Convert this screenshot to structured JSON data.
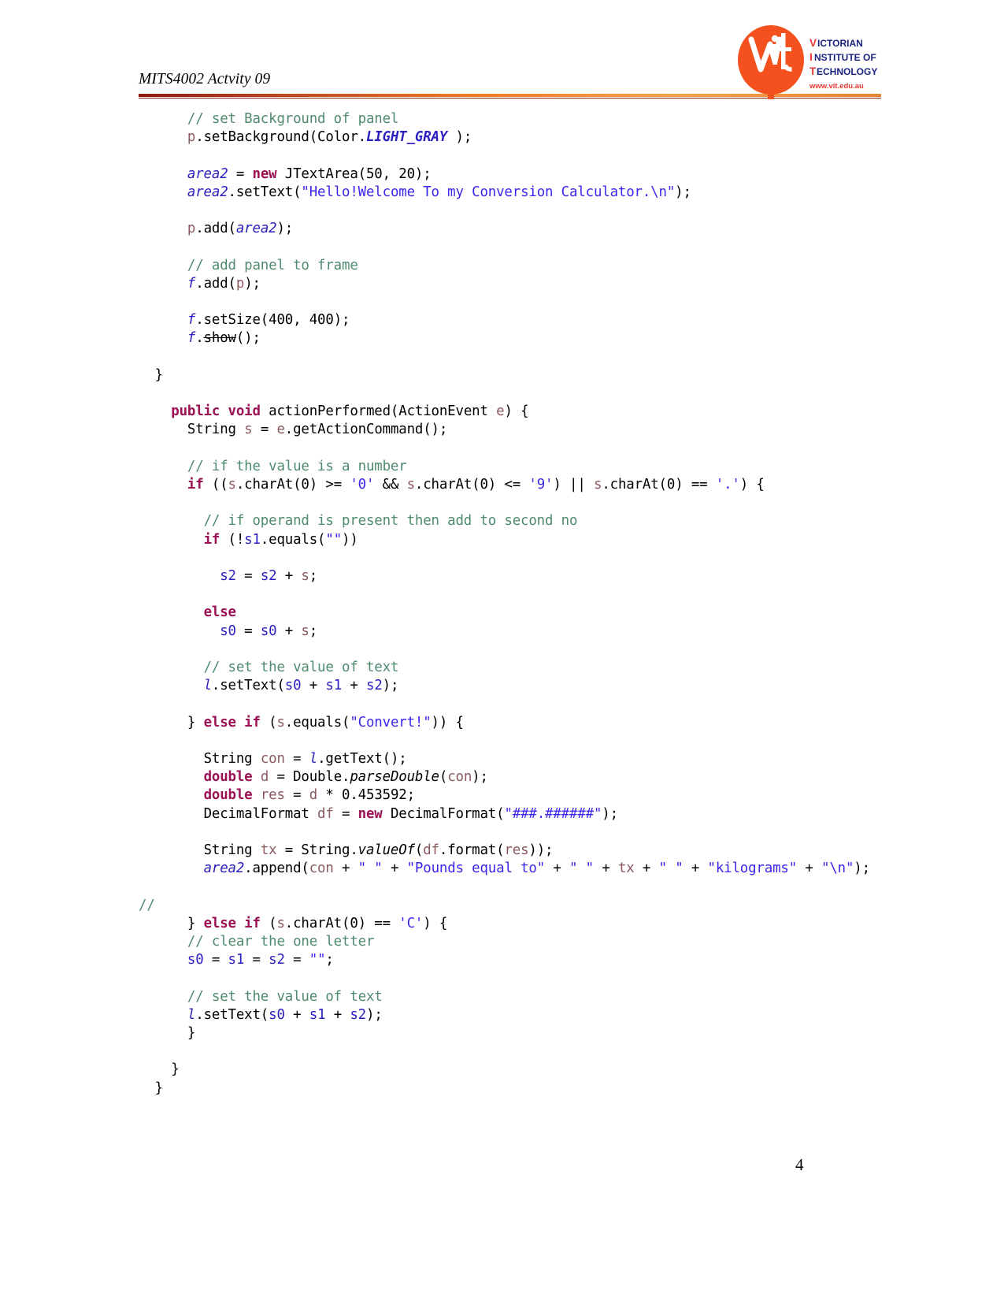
{
  "document": {
    "header_title": "MITS4002 Actvity 09",
    "page_number": "4"
  },
  "logo": {
    "name": "vit-logo",
    "mark_letters": "vit",
    "line1": "VICTORIAN",
    "line2": "INSTITUTE OF",
    "line3": "TECHNOLOGY",
    "website": "www.vit.edu.au",
    "colors": {
      "orange": "#F4511E",
      "blue": "#1A237E",
      "red": "#E53935",
      "maroon": "#7e1a10"
    }
  },
  "theme": {
    "comment": "#4f8a6d",
    "keyword": "#9c1054",
    "string": "#3b26ec",
    "field": "#2a1fbe",
    "local": "#8a5a5e",
    "text": "#000000"
  },
  "code": {
    "language": "java",
    "lines": [
      {
        "indent": 3,
        "tokens": [
          {
            "t": "cmt",
            "v": "// set Background of panel"
          }
        ]
      },
      {
        "indent": 3,
        "tokens": [
          {
            "t": "loc",
            "v": "p"
          },
          {
            "t": "plain",
            "v": ".setBackground(Color."
          },
          {
            "t": "cons",
            "v": "LIGHT_GRAY"
          },
          {
            "t": "plain",
            "v": " );"
          }
        ]
      },
      {
        "blank": true
      },
      {
        "indent": 3,
        "tokens": [
          {
            "t": "fld",
            "v": "area2"
          },
          {
            "t": "plain",
            "v": " = "
          },
          {
            "t": "kw",
            "v": "new"
          },
          {
            "t": "plain",
            "v": " JTextArea(50, 20);"
          }
        ]
      },
      {
        "indent": 3,
        "tokens": [
          {
            "t": "fld",
            "v": "area2"
          },
          {
            "t": "plain",
            "v": ".setText("
          },
          {
            "t": "str",
            "v": "\"Hello!Welcome To my Conversion Calculator.\\n\""
          },
          {
            "t": "plain",
            "v": ");"
          }
        ]
      },
      {
        "blank": true
      },
      {
        "indent": 3,
        "tokens": [
          {
            "t": "loc",
            "v": "p"
          },
          {
            "t": "plain",
            "v": ".add("
          },
          {
            "t": "fld",
            "v": "area2"
          },
          {
            "t": "plain",
            "v": ");"
          }
        ]
      },
      {
        "blank": true
      },
      {
        "indent": 3,
        "tokens": [
          {
            "t": "cmt",
            "v": "// add panel to frame"
          }
        ]
      },
      {
        "indent": 3,
        "tokens": [
          {
            "t": "fld",
            "v": "f"
          },
          {
            "t": "plain",
            "v": ".add("
          },
          {
            "t": "loc",
            "v": "p"
          },
          {
            "t": "plain",
            "v": ");"
          }
        ]
      },
      {
        "blank": true
      },
      {
        "indent": 3,
        "tokens": [
          {
            "t": "fld",
            "v": "f"
          },
          {
            "t": "plain",
            "v": ".setSize(400, 400);"
          }
        ]
      },
      {
        "indent": 3,
        "tokens": [
          {
            "t": "fld",
            "v": "f"
          },
          {
            "t": "plain",
            "v": "."
          },
          {
            "t": "strike",
            "v": "show"
          },
          {
            "t": "plain",
            "v": "();"
          }
        ]
      },
      {
        "blank": true
      },
      {
        "indent": 1,
        "tokens": [
          {
            "t": "plain",
            "v": "}"
          }
        ]
      },
      {
        "blank": true
      },
      {
        "indent": 2,
        "tokens": [
          {
            "t": "kw",
            "v": "public void"
          },
          {
            "t": "plain",
            "v": " actionPerformed(ActionEvent "
          },
          {
            "t": "loc",
            "v": "e"
          },
          {
            "t": "plain",
            "v": ") {"
          }
        ]
      },
      {
        "indent": 3,
        "tokens": [
          {
            "t": "plain",
            "v": "String "
          },
          {
            "t": "loc",
            "v": "s"
          },
          {
            "t": "plain",
            "v": " = "
          },
          {
            "t": "loc",
            "v": "e"
          },
          {
            "t": "plain",
            "v": ".getActionCommand();"
          }
        ]
      },
      {
        "blank": true
      },
      {
        "indent": 3,
        "tokens": [
          {
            "t": "cmt",
            "v": "// if the value is a number"
          }
        ]
      },
      {
        "indent": 3,
        "wrap": true,
        "tokens": [
          {
            "t": "kw",
            "v": "if"
          },
          {
            "t": "plain",
            "v": " (("
          },
          {
            "t": "loc",
            "v": "s"
          },
          {
            "t": "plain",
            "v": ".charAt(0) >= "
          },
          {
            "t": "chr",
            "v": "'0'"
          },
          {
            "t": "plain",
            "v": " && "
          },
          {
            "t": "loc",
            "v": "s"
          },
          {
            "t": "plain",
            "v": ".charAt(0) <= "
          },
          {
            "t": "chr",
            "v": "'9'"
          },
          {
            "t": "plain",
            "v": ") || "
          },
          {
            "t": "loc",
            "v": "s"
          },
          {
            "t": "plain",
            "v": ".charAt(0) == "
          },
          {
            "t": "chr",
            "v": "'.'"
          },
          {
            "t": "plain",
            "v": ") {"
          }
        ]
      },
      {
        "blank": true
      },
      {
        "indent": 4,
        "tokens": [
          {
            "t": "cmt",
            "v": "// if operand is present then add to second no"
          }
        ]
      },
      {
        "indent": 4,
        "tokens": [
          {
            "t": "kw",
            "v": "if"
          },
          {
            "t": "plain",
            "v": " (!"
          },
          {
            "t": "var",
            "v": "s1"
          },
          {
            "t": "plain",
            "v": ".equals("
          },
          {
            "t": "str",
            "v": "\"\""
          },
          {
            "t": "plain",
            "v": "))"
          }
        ]
      },
      {
        "blank": true
      },
      {
        "indent": 5,
        "tokens": [
          {
            "t": "var",
            "v": "s2"
          },
          {
            "t": "plain",
            "v": " = "
          },
          {
            "t": "var",
            "v": "s2"
          },
          {
            "t": "plain",
            "v": " + "
          },
          {
            "t": "loc",
            "v": "s"
          },
          {
            "t": "plain",
            "v": ";"
          }
        ]
      },
      {
        "blank": true
      },
      {
        "indent": 4,
        "tokens": [
          {
            "t": "kw",
            "v": "else"
          }
        ]
      },
      {
        "indent": 5,
        "tokens": [
          {
            "t": "var",
            "v": "s0"
          },
          {
            "t": "plain",
            "v": " = "
          },
          {
            "t": "var",
            "v": "s0"
          },
          {
            "t": "plain",
            "v": " + "
          },
          {
            "t": "loc",
            "v": "s"
          },
          {
            "t": "plain",
            "v": ";"
          }
        ]
      },
      {
        "blank": true
      },
      {
        "indent": 4,
        "tokens": [
          {
            "t": "cmt",
            "v": "// set the value of text"
          }
        ]
      },
      {
        "indent": 4,
        "tokens": [
          {
            "t": "fld",
            "v": "l"
          },
          {
            "t": "plain",
            "v": ".setText("
          },
          {
            "t": "var",
            "v": "s0"
          },
          {
            "t": "plain",
            "v": " + "
          },
          {
            "t": "var",
            "v": "s1"
          },
          {
            "t": "plain",
            "v": " + "
          },
          {
            "t": "var",
            "v": "s2"
          },
          {
            "t": "plain",
            "v": ");"
          }
        ]
      },
      {
        "blank": true
      },
      {
        "indent": 3,
        "tokens": [
          {
            "t": "plain",
            "v": "} "
          },
          {
            "t": "kw",
            "v": "else if"
          },
          {
            "t": "plain",
            "v": " ("
          },
          {
            "t": "loc",
            "v": "s"
          },
          {
            "t": "plain",
            "v": ".equals("
          },
          {
            "t": "str",
            "v": "\"Convert!\""
          },
          {
            "t": "plain",
            "v": ")) {"
          }
        ]
      },
      {
        "blank": true
      },
      {
        "indent": 4,
        "tokens": [
          {
            "t": "plain",
            "v": "String "
          },
          {
            "t": "loc",
            "v": "con"
          },
          {
            "t": "plain",
            "v": " = "
          },
          {
            "t": "fld",
            "v": "l"
          },
          {
            "t": "plain",
            "v": ".getText();"
          }
        ]
      },
      {
        "indent": 4,
        "tokens": [
          {
            "t": "kw",
            "v": "double"
          },
          {
            "t": "plain",
            "v": " "
          },
          {
            "t": "loc",
            "v": "d"
          },
          {
            "t": "plain",
            "v": " = Double."
          },
          {
            "t": "mth",
            "v": "parseDouble"
          },
          {
            "t": "plain",
            "v": "("
          },
          {
            "t": "loc",
            "v": "con"
          },
          {
            "t": "plain",
            "v": ");"
          }
        ]
      },
      {
        "indent": 4,
        "tokens": [
          {
            "t": "kw",
            "v": "double"
          },
          {
            "t": "plain",
            "v": " "
          },
          {
            "t": "loc",
            "v": "res"
          },
          {
            "t": "plain",
            "v": " = "
          },
          {
            "t": "loc",
            "v": "d"
          },
          {
            "t": "plain",
            "v": " * 0.453592;"
          }
        ]
      },
      {
        "indent": 4,
        "tokens": [
          {
            "t": "plain",
            "v": "DecimalFormat "
          },
          {
            "t": "loc",
            "v": "df"
          },
          {
            "t": "plain",
            "v": " = "
          },
          {
            "t": "kw",
            "v": "new"
          },
          {
            "t": "plain",
            "v": " DecimalFormat("
          },
          {
            "t": "str",
            "v": "\"###.######\""
          },
          {
            "t": "plain",
            "v": ");"
          }
        ]
      },
      {
        "blank": true
      },
      {
        "indent": 4,
        "tokens": [
          {
            "t": "plain",
            "v": "String "
          },
          {
            "t": "loc",
            "v": "tx"
          },
          {
            "t": "plain",
            "v": " = String."
          },
          {
            "t": "mth",
            "v": "valueOf"
          },
          {
            "t": "plain",
            "v": "("
          },
          {
            "t": "loc",
            "v": "df"
          },
          {
            "t": "plain",
            "v": ".format("
          },
          {
            "t": "loc",
            "v": "res"
          },
          {
            "t": "plain",
            "v": "));"
          }
        ]
      },
      {
        "indent": 4,
        "wrap": true,
        "tokens": [
          {
            "t": "fld",
            "v": "area2"
          },
          {
            "t": "plain",
            "v": ".append("
          },
          {
            "t": "loc",
            "v": "con"
          },
          {
            "t": "plain",
            "v": " + "
          },
          {
            "t": "str",
            "v": "\" \""
          },
          {
            "t": "plain",
            "v": " + "
          },
          {
            "t": "str",
            "v": "\"Pounds equal to\""
          },
          {
            "t": "plain",
            "v": " + "
          },
          {
            "t": "str",
            "v": "\" \""
          },
          {
            "t": "plain",
            "v": " + "
          },
          {
            "t": "loc",
            "v": "tx"
          },
          {
            "t": "plain",
            "v": " + "
          },
          {
            "t": "str",
            "v": "\" \""
          },
          {
            "t": "plain",
            "v": " + "
          },
          {
            "t": "str",
            "v": "\"kilograms\""
          },
          {
            "t": "plain",
            "v": " + "
          },
          {
            "t": "str",
            "v": "\"\\n\""
          },
          {
            "t": "plain",
            "v": ");"
          }
        ]
      },
      {
        "blank": true
      },
      {
        "indent": 0,
        "tokens": [
          {
            "t": "cmt",
            "v": "//"
          }
        ]
      },
      {
        "indent": 3,
        "tokens": [
          {
            "t": "plain",
            "v": "} "
          },
          {
            "t": "kw",
            "v": "else if"
          },
          {
            "t": "plain",
            "v": " ("
          },
          {
            "t": "loc",
            "v": "s"
          },
          {
            "t": "plain",
            "v": ".charAt(0) == "
          },
          {
            "t": "chr",
            "v": "'C'"
          },
          {
            "t": "plain",
            "v": ") {"
          }
        ]
      },
      {
        "indent": 3,
        "tokens": [
          {
            "t": "cmt",
            "v": "// clear the one letter"
          }
        ]
      },
      {
        "indent": 3,
        "tokens": [
          {
            "t": "var",
            "v": "s0"
          },
          {
            "t": "plain",
            "v": " = "
          },
          {
            "t": "var",
            "v": "s1"
          },
          {
            "t": "plain",
            "v": " = "
          },
          {
            "t": "var",
            "v": "s2"
          },
          {
            "t": "plain",
            "v": " = "
          },
          {
            "t": "str",
            "v": "\"\""
          },
          {
            "t": "plain",
            "v": ";"
          }
        ]
      },
      {
        "blank": true
      },
      {
        "indent": 3,
        "tokens": [
          {
            "t": "cmt",
            "v": "// set the value of text"
          }
        ]
      },
      {
        "indent": 3,
        "tokens": [
          {
            "t": "fld",
            "v": "l"
          },
          {
            "t": "plain",
            "v": ".setText("
          },
          {
            "t": "var",
            "v": "s0"
          },
          {
            "t": "plain",
            "v": " + "
          },
          {
            "t": "var",
            "v": "s1"
          },
          {
            "t": "plain",
            "v": " + "
          },
          {
            "t": "var",
            "v": "s2"
          },
          {
            "t": "plain",
            "v": ");"
          }
        ]
      },
      {
        "indent": 3,
        "tokens": [
          {
            "t": "plain",
            "v": "}"
          }
        ]
      },
      {
        "blank": true
      },
      {
        "indent": 2,
        "tokens": [
          {
            "t": "plain",
            "v": "}"
          }
        ]
      },
      {
        "indent": 1,
        "tokens": [
          {
            "t": "plain",
            "v": "}"
          }
        ]
      }
    ]
  }
}
